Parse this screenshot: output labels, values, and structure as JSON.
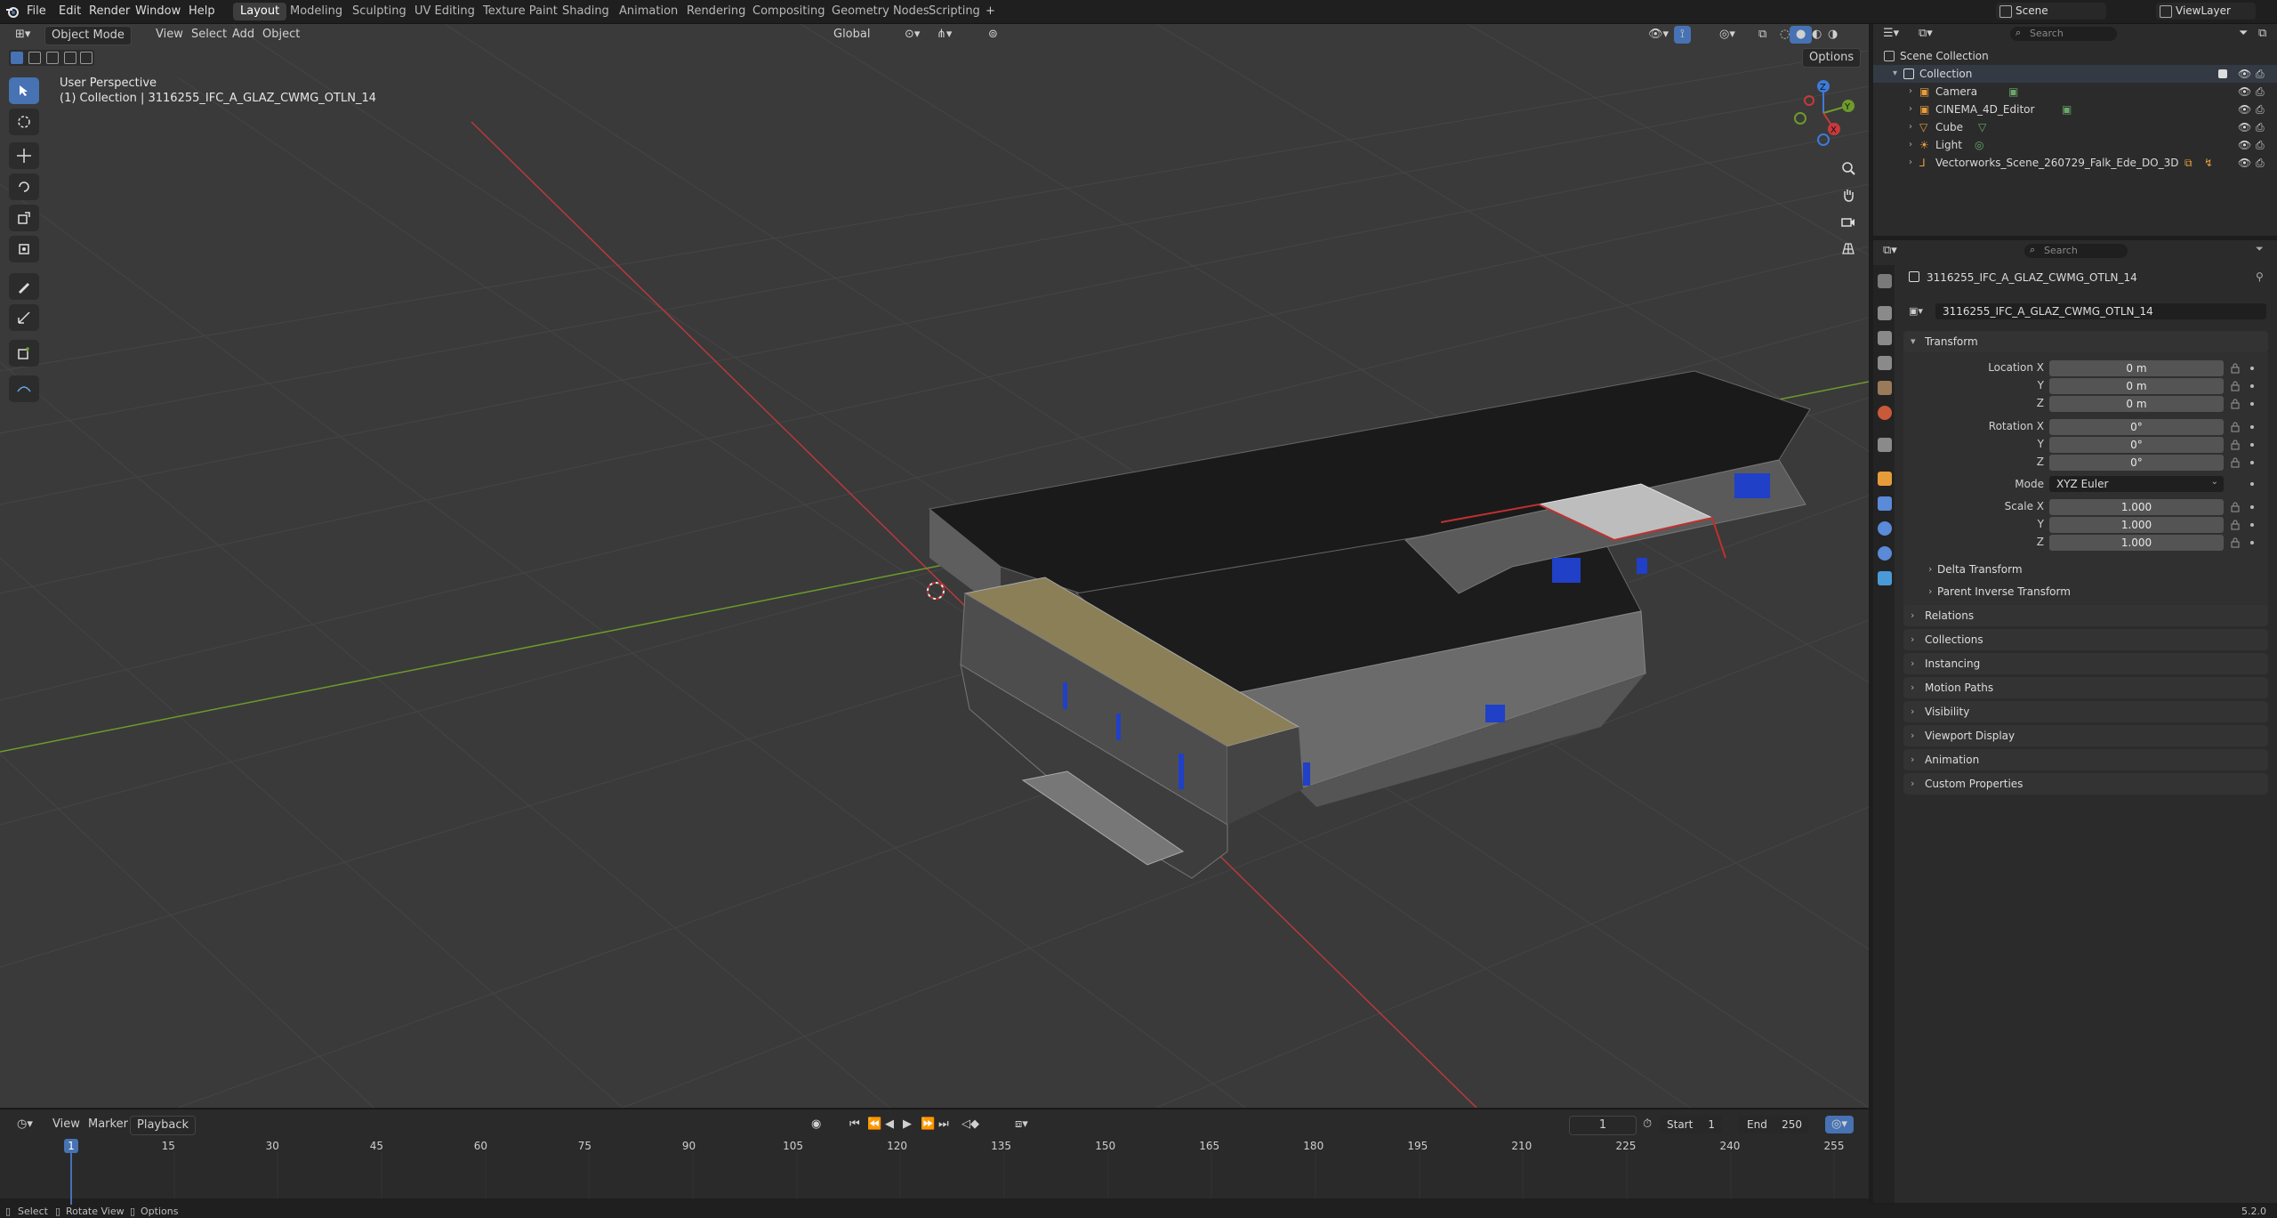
{
  "topbar": {
    "menus": [
      "File",
      "Edit",
      "Render",
      "Window",
      "Help"
    ],
    "workspaces": [
      "Layout",
      "Modeling",
      "Sculpting",
      "UV Editing",
      "Texture Paint",
      "Shading",
      "Animation",
      "Rendering",
      "Compositing",
      "Geometry Nodes",
      "Scripting"
    ],
    "active_workspace": "Layout",
    "scene_label": "Scene",
    "viewlayer_label": "ViewLayer"
  },
  "viewport_header": {
    "mode": "Object Mode",
    "menus": [
      "View",
      "Select",
      "Add",
      "Object"
    ],
    "orientation": "Global",
    "options_label": "Options"
  },
  "viewport": {
    "perspective": "User Perspective",
    "collection_info": "(1) Collection | 3116255_IFC_A_GLAZ_CWMG_OTLN_14",
    "gizmo_axes": [
      "X",
      "Y",
      "Z"
    ]
  },
  "outliner": {
    "search_placeholder": "Search",
    "root": "Scene Collection",
    "collection": "Collection",
    "items": [
      "Camera",
      "CINEMA_4D_Editor",
      "Cube",
      "Light",
      "Vectorworks_Scene_260729_Falk_Ede_DO_3D"
    ]
  },
  "properties": {
    "search_placeholder": "Search",
    "object_name": "3116255_IFC_A_GLAZ_CWMG_OTLN_14",
    "data_name": "3116255_IFC_A_GLAZ_CWMG_OTLN_14",
    "transform_label": "Transform",
    "location": {
      "label_x": "Location X",
      "label_y": "Y",
      "label_z": "Z",
      "x": "0 m",
      "y": "0 m",
      "z": "0 m"
    },
    "rotation": {
      "label_x": "Rotation X",
      "label_y": "Y",
      "label_z": "Z",
      "x": "0°",
      "y": "0°",
      "z": "0°"
    },
    "mode_label": "Mode",
    "mode_value": "XYZ Euler",
    "scale": {
      "label_x": "Scale X",
      "label_y": "Y",
      "label_z": "Z",
      "x": "1.000",
      "y": "1.000",
      "z": "1.000"
    },
    "subpanels": [
      "Delta Transform",
      "Parent Inverse Transform"
    ],
    "panels": [
      "Relations",
      "Collections",
      "Instancing",
      "Motion Paths",
      "Visibility",
      "Viewport Display",
      "Animation",
      "Custom Properties"
    ]
  },
  "timeline": {
    "menus": [
      "View",
      "Marker",
      "Playback"
    ],
    "current_frame": "1",
    "start_label": "Start",
    "start_value": "1",
    "end_label": "End",
    "end_value": "250",
    "ticks": [
      "1",
      "15",
      "30",
      "45",
      "60",
      "75",
      "90",
      "105",
      "120",
      "135",
      "150",
      "165",
      "180",
      "195",
      "210",
      "225",
      "240",
      "255"
    ]
  },
  "statusbar": {
    "items": [
      "Select",
      "Rotate View",
      "Options"
    ],
    "version": "5.2.0"
  },
  "colors": {
    "accent": "#4772b3",
    "x_axis": "#c8393b",
    "y_axis": "#6e9b2b",
    "z_axis": "#3d7bd8",
    "building_roof": "#1b1b1b",
    "building_facade": "#7a7a7a",
    "beige_roof": "#8b7f58",
    "window_blue": "#2040c8"
  }
}
